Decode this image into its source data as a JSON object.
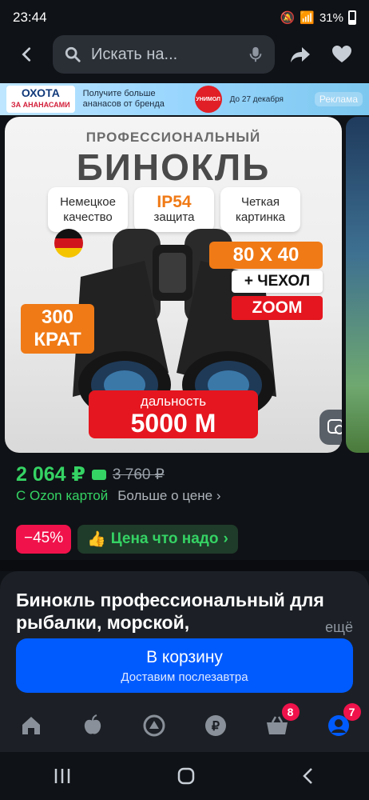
{
  "status_bar": {
    "time": "23:44",
    "battery": "31%"
  },
  "top_nav": {
    "search_placeholder": "Искать на..."
  },
  "banner": {
    "brand_line1": "ОХОТА",
    "brand_line2": "ЗА АНАНАСАМИ",
    "text": "Получите больше ананасов от бренда",
    "logo": "УНИМОЛ",
    "date": "До 27 декабря",
    "ad_label": "Реклама"
  },
  "product_image": {
    "subtitle": "ПРОФЕССИОНАЛЬНЫЙ",
    "title": "БИНОКЛЬ",
    "feature_1": "Немецкое качество",
    "feature_2_top": "IP54",
    "feature_2_bottom": "защита",
    "feature_3": "Четкая картинка",
    "spec_size": "80 X 40",
    "spec_case": "+ ЧЕХОЛ",
    "spec_zoom": "ZOOM",
    "zoom_top": "300",
    "zoom_bottom": "КРАТ",
    "range_label": "дальность",
    "range_value": "5000 М"
  },
  "price": {
    "current": "2 064 ₽",
    "old": "3 760 ₽",
    "ozon_card": "С Ozon картой",
    "more_about_price": "Больше о цене"
  },
  "chips": {
    "discount": "−45%",
    "good_price": "Цена что надо"
  },
  "product": {
    "title": "Бинокль профессиональный для рыбалки, морской,",
    "more": "ещё"
  },
  "cart_button": {
    "label": "В корзину",
    "sub": "Доставим послезавтра"
  },
  "bottom_nav": {
    "cart_badge": "8",
    "profile_badge": "7"
  },
  "colors": {
    "accent_blue": "#005bff",
    "price_green": "#35d364",
    "discount_red": "#f0124b"
  }
}
